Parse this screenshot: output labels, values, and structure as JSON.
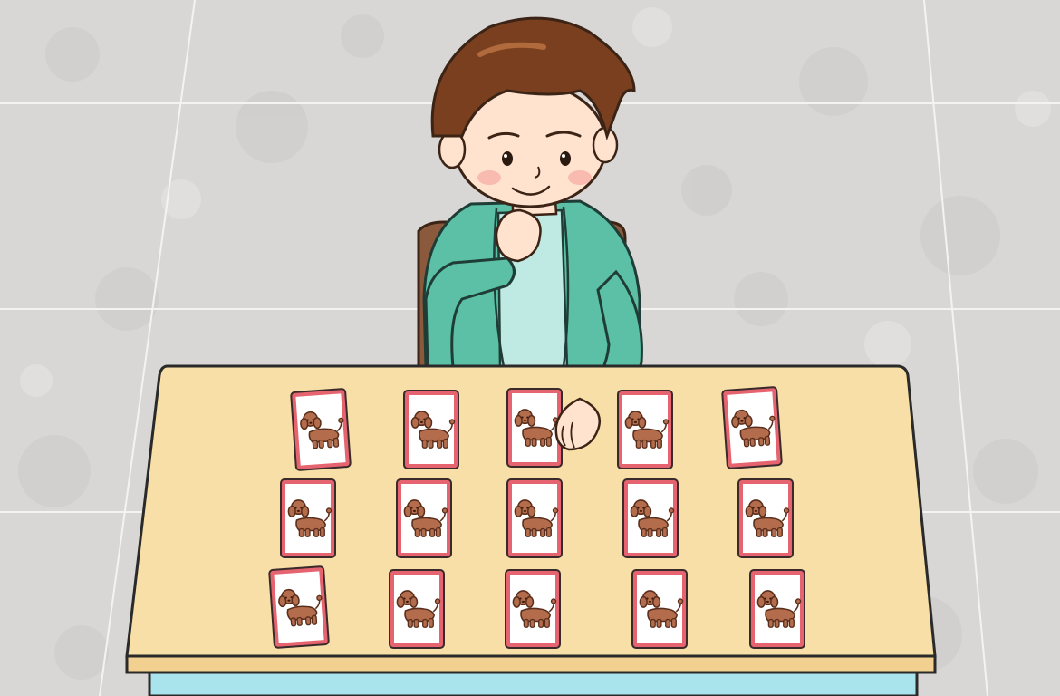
{
  "scene": {
    "background_color": "#d9d7d6",
    "grid_line_color": "#f4f3f2",
    "table_top_color": "#f7dfa7",
    "table_edge_color": "#f2d08f",
    "table_front_color": "#a9e3ec",
    "card_border_color": "#e5646f",
    "card_face_color": "#ffffff",
    "dog_color": "#b46d4c",
    "cardigan_color": "#5bc0a5",
    "shirt_color": "#bfe9e3",
    "hair_color": "#7a3f1f",
    "skin_color": "#ffe3cf",
    "chair_color": "#8b5a3c"
  },
  "character": {
    "icon": "boy-thinking-icon"
  },
  "cards": {
    "icon": "poodle-icon",
    "face_down": false,
    "rows": 3,
    "columns": 5,
    "total": 15
  }
}
